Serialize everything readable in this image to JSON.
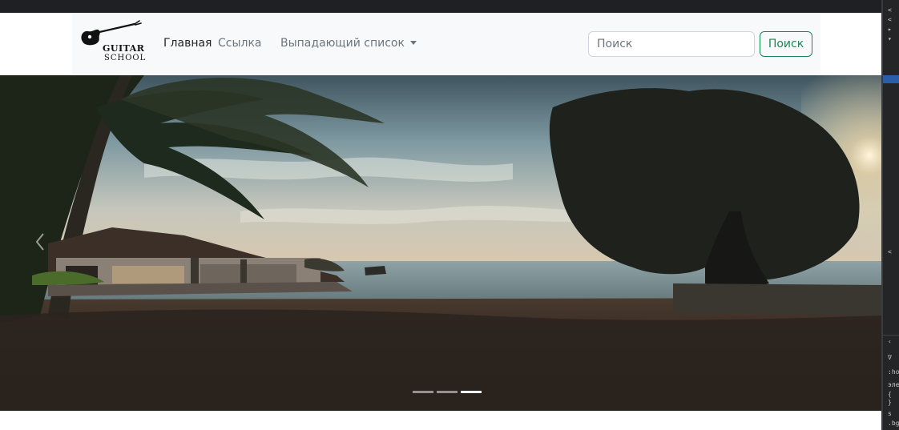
{
  "brand": {
    "line1": "GUITAR",
    "line2": "SCHOOL",
    "logo_icon": "guitar-icon"
  },
  "nav": {
    "items": [
      {
        "label": "Главная",
        "active": true
      },
      {
        "label": "Ссылка",
        "active": false
      },
      {
        "label": "Выпадающий список",
        "active": false,
        "dropdown": true
      }
    ]
  },
  "search": {
    "placeholder": "Поиск",
    "value": "",
    "button_label": "Поиск"
  },
  "carousel": {
    "slide_count": 3,
    "active_index": 2,
    "prev_icon": "chevron-left-icon",
    "next_icon": "chevron-right-icon"
  },
  "colors": {
    "navbar_bg": "#f8f9fa",
    "accent": "#198754",
    "nav_active": "#212529",
    "nav_muted": "#6c757d"
  },
  "devtools": {
    "lines": [
      "<",
      "<",
      "▸",
      "▾",
      "<",
      "‹",
      "∇",
      ":hov",
      "эле",
      "{",
      "}",
      "s",
      ".bg"
    ]
  }
}
